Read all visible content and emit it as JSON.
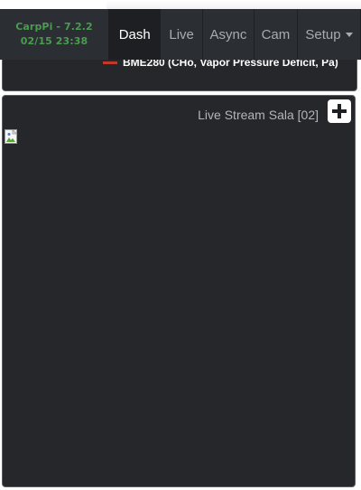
{
  "brand": {
    "name_version": "CarpPi - 7.2.2",
    "datetime": "02/15 23:38"
  },
  "nav": {
    "items": [
      {
        "label": "Dash",
        "active": true
      },
      {
        "label": "Live",
        "active": false
      },
      {
        "label": "Async",
        "active": false
      },
      {
        "label": "Cam",
        "active": false
      },
      {
        "label": "Setup",
        "active": false,
        "dropdown": true
      }
    ]
  },
  "top_card": {
    "legend_label": "BME280 (CHo, Vapor Pressure Deficit, Pa)",
    "legend_color": "#c0392b"
  },
  "stream_card": {
    "title": "Live Stream Sala [02]",
    "add_icon": "plus-icon",
    "image_icon": "broken-image-icon"
  },
  "colors": {
    "navbar_bg": "#2b2e33",
    "active_tab_bg": "#1d1f22",
    "card_bg": "#25272b",
    "brand_green": "#4a9c4f"
  }
}
